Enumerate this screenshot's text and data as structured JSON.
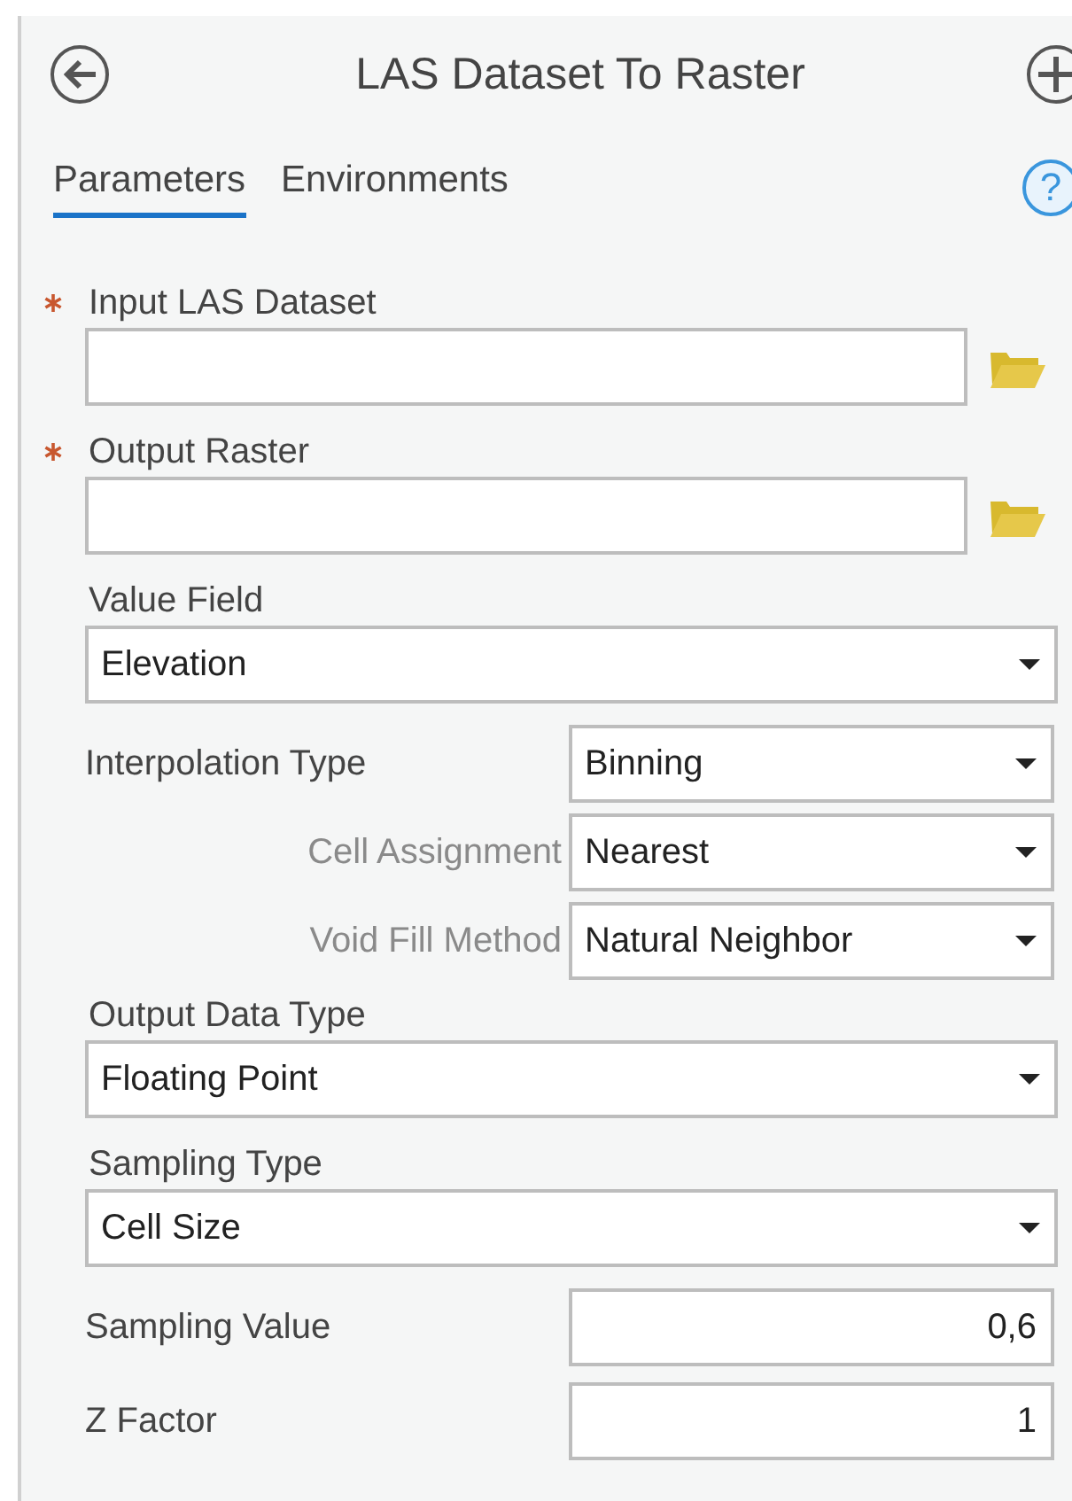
{
  "header": {
    "title": "LAS Dataset To Raster"
  },
  "tabs": [
    {
      "label": "Parameters",
      "selected": true
    },
    {
      "label": "Environments",
      "selected": false
    }
  ],
  "help": {
    "symbol": "?"
  },
  "parameters": [
    {
      "kind": "path",
      "label": "Input LAS Dataset",
      "required": true
    },
    {
      "kind": "path",
      "label": "Output Raster",
      "required": true
    },
    {
      "kind": "dropdown",
      "label": "Value Field",
      "value": "Elevation"
    },
    {
      "kind": "inline_dropdown",
      "label": "Interpolation Type",
      "value": "Binning"
    },
    {
      "kind": "sub_dropdown",
      "label": "Cell Assignment",
      "value": "Nearest"
    },
    {
      "kind": "sub_dropdown",
      "label": "Void Fill Method",
      "value": "Natural Neighbor"
    },
    {
      "kind": "dropdown",
      "label": "Output Data Type",
      "value": "Floating Point"
    },
    {
      "kind": "dropdown",
      "label": "Sampling Type",
      "value": "Cell Size"
    },
    {
      "kind": "number",
      "label": "Sampling Value",
      "value": "0,6"
    },
    {
      "kind": "number",
      "label": "Z Factor",
      "value": "1"
    }
  ]
}
